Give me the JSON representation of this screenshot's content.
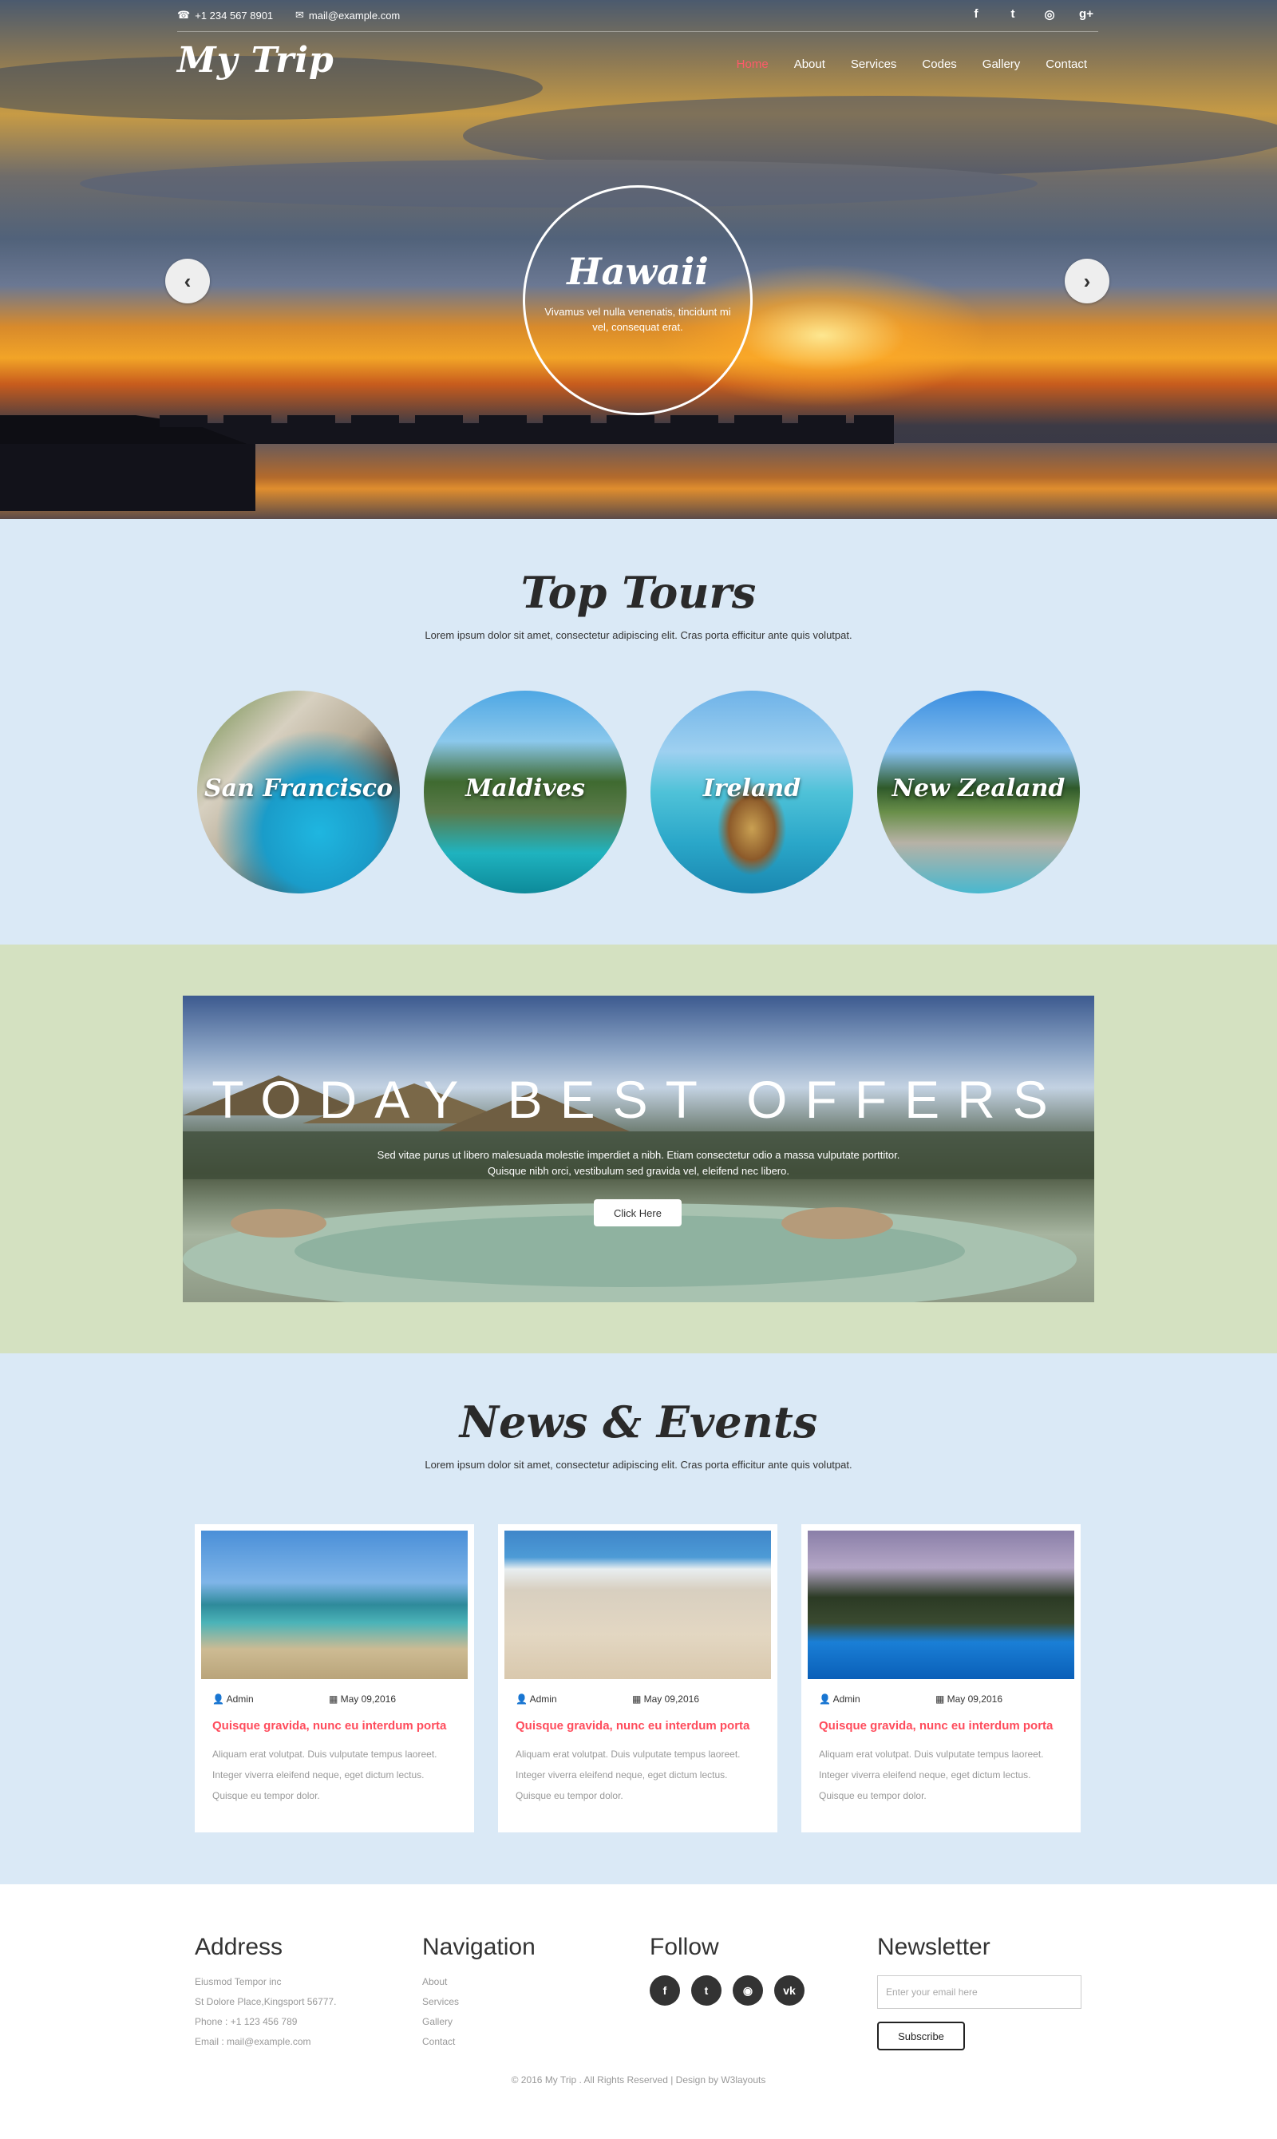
{
  "topbar": {
    "phone": "+1 234 567 8901",
    "email": "mail@example.com",
    "social": [
      {
        "icon": "facebook-icon",
        "glyph": "f"
      },
      {
        "icon": "twitter-icon",
        "glyph": "t"
      },
      {
        "icon": "dribbble-icon",
        "glyph": "◎"
      },
      {
        "icon": "google-plus-icon",
        "glyph": "g+"
      }
    ]
  },
  "logo": "My Trip",
  "nav": [
    "Home",
    "About",
    "Services",
    "Codes",
    "Gallery",
    "Contact"
  ],
  "hero": {
    "title": "Hawaii",
    "text": "Vivamus vel nulla venenatis, tincidunt mi vel, consequat erat.",
    "prev": "‹",
    "next": "›"
  },
  "tours": {
    "title": "Top Tours",
    "subtitle": "Lorem ipsum dolor sit amet, consectetur adipiscing elit. Cras porta efficitur ante quis volutpat.",
    "items": [
      "San Francisco",
      "Maldives",
      "Ireland",
      "New Zealand"
    ]
  },
  "offers": {
    "title": "TODAY BEST OFFERS",
    "text": "Sed vitae purus ut libero malesuada molestie imperdiet a nibh. Etiam consectetur odio a massa vulputate porttitor. Quisque nibh orci, vestibulum sed gravida vel, eleifend nec libero.",
    "button": "Click Here"
  },
  "news": {
    "title": "News & Events",
    "subtitle": "Lorem ipsum dolor sit amet, consectetur adipiscing elit. Cras porta efficitur ante quis volutpat.",
    "cards": [
      {
        "author": "Admin",
        "date": "May 09,2016",
        "title": "Quisque gravida, nunc eu interdum porta",
        "text": "Aliquam erat volutpat. Duis vulputate tempus laoreet. Integer viverra eleifend neque, eget dictum lectus. Quisque eu tempor dolor."
      },
      {
        "author": "Admin",
        "date": "May 09,2016",
        "title": "Quisque gravida, nunc eu interdum porta",
        "text": "Aliquam erat volutpat. Duis vulputate tempus laoreet. Integer viverra eleifend neque, eget dictum lectus. Quisque eu tempor dolor."
      },
      {
        "author": "Admin",
        "date": "May 09,2016",
        "title": "Quisque gravida, nunc eu interdum porta",
        "text": "Aliquam erat volutpat. Duis vulputate tempus laoreet. Integer viverra eleifend neque, eget dictum lectus. Quisque eu tempor dolor."
      }
    ]
  },
  "footer": {
    "address": {
      "title": "Address",
      "lines": [
        "Eiusmod Tempor inc",
        "St Dolore Place,Kingsport 56777.",
        "Phone : +1 123 456 789",
        "Email : mail@example.com"
      ]
    },
    "navigation": {
      "title": "Navigation",
      "links": [
        "About",
        "Services",
        "Gallery",
        "Contact"
      ]
    },
    "follow": {
      "title": "Follow",
      "icons": [
        {
          "icon": "facebook-icon",
          "glyph": "f"
        },
        {
          "icon": "twitter-icon",
          "glyph": "t"
        },
        {
          "icon": "rss-icon",
          "glyph": "◉"
        },
        {
          "icon": "vk-icon",
          "glyph": "vk"
        }
      ]
    },
    "newsletter": {
      "title": "Newsletter",
      "placeholder": "Enter your email here",
      "button": "Subscribe"
    },
    "copyright": "© 2016 My Trip . All Rights Reserved | Design by W3layouts"
  },
  "colors": {
    "accent": "#ff5a6a",
    "tours_bg": "#dae9f6",
    "offers_bg": "#d4e1c1"
  }
}
